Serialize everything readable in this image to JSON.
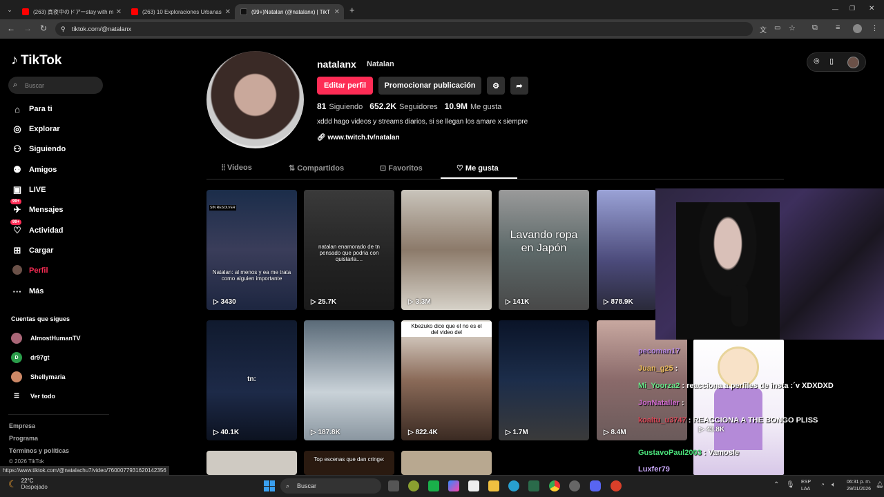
{
  "browser": {
    "tabs": [
      {
        "title": "(263) 真夜中のドアーstay with m"
      },
      {
        "title": "(263) 10 Exploraciones Urbanas"
      },
      {
        "title": "(99+)Natalan (@natalanx) | TikT"
      }
    ],
    "url": "tiktok.com/@natalanx",
    "status_url": "https://www.tiktok.com/@natalachu7/video/7600077931620142356"
  },
  "sidebar": {
    "logo": "TikTok",
    "search_placeholder": "Buscar",
    "items": [
      {
        "label": "Para ti",
        "icon": "home-icon"
      },
      {
        "label": "Explorar",
        "icon": "compass-icon"
      },
      {
        "label": "Siguiendo",
        "icon": "following-icon"
      },
      {
        "label": "Amigos",
        "icon": "friends-icon"
      },
      {
        "label": "LIVE",
        "icon": "live-icon"
      },
      {
        "label": "Mensajes",
        "icon": "messages-icon",
        "badge": "99+"
      },
      {
        "label": "Actividad",
        "icon": "activity-icon",
        "badge": "99+"
      },
      {
        "label": "Cargar",
        "icon": "upload-icon"
      },
      {
        "label": "Perfil",
        "icon": "profile-icon"
      },
      {
        "label": "Más",
        "icon": "more-icon"
      }
    ],
    "following_title": "Cuentas que sigues",
    "following": [
      {
        "name": "AlmostHumanTV"
      },
      {
        "name": "dr97gt",
        "initial": "D"
      },
      {
        "name": "Shellymaria"
      }
    ],
    "see_all": "Ver todo",
    "footer": [
      "Empresa",
      "Programa",
      "Términos y políticas",
      "© 2026 TikTok"
    ]
  },
  "profile": {
    "username": "natalanx",
    "display_name": "Natalan",
    "edit_button": "Editar perfil",
    "promote_button": "Promocionar publicación",
    "stats": [
      {
        "value": "81",
        "label": "Siguiendo"
      },
      {
        "value": "652.2K",
        "label": "Seguidores"
      },
      {
        "value": "10.9M",
        "label": "Me gusta"
      }
    ],
    "bio": "xddd hago videos y streams diarios, si se llegan los amare x siempre",
    "link": "www.twitch.tv/natalan",
    "tabs": [
      "Videos",
      "Compartidos",
      "Favoritos",
      "Me gusta"
    ]
  },
  "videos": [
    {
      "views": "3430",
      "text": "Natalan: al menos y ea me trata como alguien importante",
      "tag": "SIN RESOLVER"
    },
    {
      "views": "25.7K",
      "text": "natalan enamorado de tn pensado que podria con quistarla...."
    },
    {
      "views": "3.3M",
      "text": ""
    },
    {
      "views": "141K",
      "text": "Lavando ropa en Japón"
    },
    {
      "views": "878.9K",
      "text": ""
    },
    {
      "views": "40.1K",
      "text": "tn:"
    },
    {
      "views": "187.8K",
      "text": ""
    },
    {
      "views": "822.4K",
      "text": "Kbezuko dice que el no es el del video del"
    },
    {
      "views": "1.7M",
      "text": ""
    },
    {
      "views": "8.4M",
      "text": ""
    },
    {
      "views": "43.8K",
      "text": ""
    },
    {
      "views": "",
      "text": "Top escenas que dan cringe:"
    }
  ],
  "stream_chat": [
    {
      "user": "pecoman17",
      "msg": ""
    },
    {
      "user": "Juan_g25",
      "msg": ""
    },
    {
      "user": "Mi_Yoorza2",
      "msg": "reacciona a perfiles de insta :´v XDXDXD"
    },
    {
      "user": "JonNataller",
      "msg": ""
    },
    {
      "user": "koaltu_u3747",
      "msg": "REACCIONA A THE BONGO PLISS"
    },
    {
      "user": "GustavoPaul2003",
      "msg": "Vamosle"
    },
    {
      "user": "Luxfer79",
      "msg": ""
    }
  ],
  "taskbar": {
    "weather_temp": "22°C",
    "weather_desc": "Despejado",
    "search": "Buscar",
    "lang": "ESP",
    "lang2": "LAA",
    "time": "06:31 p. m.",
    "date": "29/01/2026"
  }
}
